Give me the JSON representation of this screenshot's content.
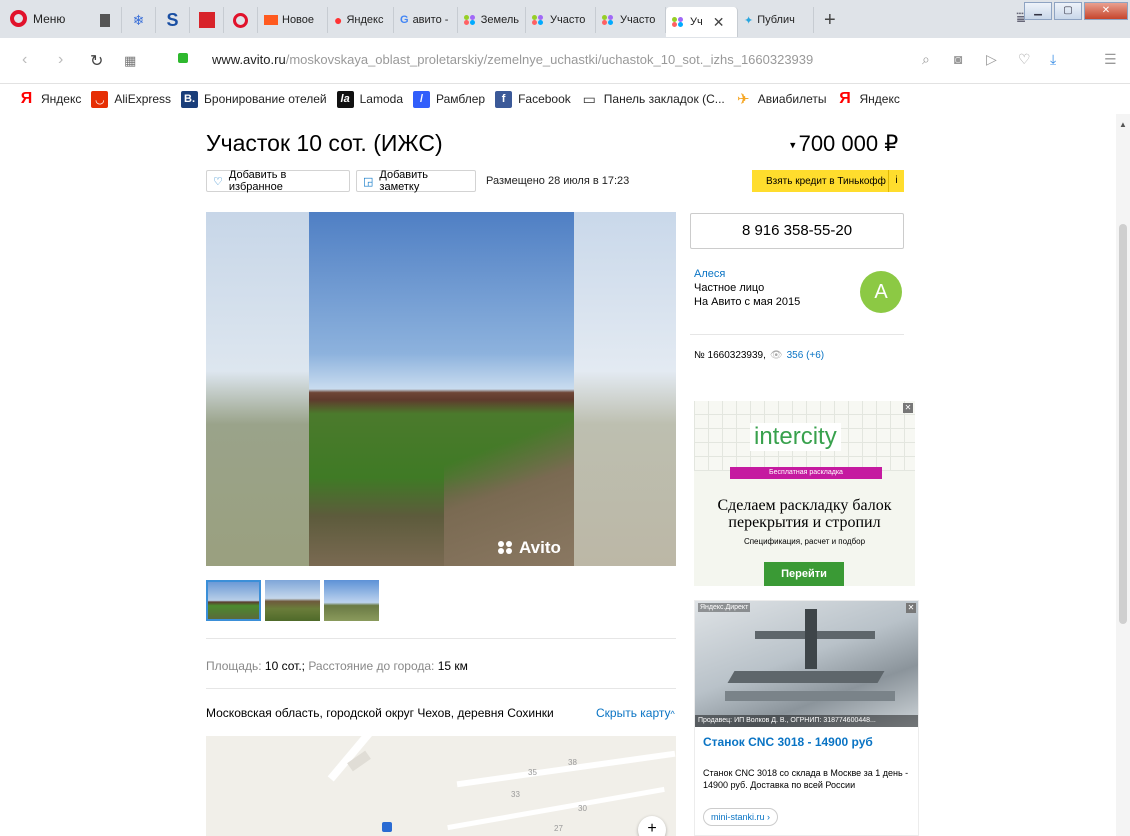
{
  "browser": {
    "menu_label": "Меню",
    "tabs": [
      {
        "label": "Новое"
      },
      {
        "label": "Яндекс"
      },
      {
        "label": "авито -"
      },
      {
        "label": "Земель"
      },
      {
        "label": "Участо"
      },
      {
        "label": "Участо"
      },
      {
        "label": "Уч"
      },
      {
        "label": "Публич"
      }
    ],
    "url_domain": "www.avito.ru",
    "url_path": "/moskovskaya_oblast_proletarskiy/zemelnye_uchastki/uchastok_10_sot._izhs_1660323939",
    "bookmarks": [
      {
        "label": "Яндекс"
      },
      {
        "label": "AliExpress"
      },
      {
        "label": "Бронирование отелей"
      },
      {
        "label": "Lamoda"
      },
      {
        "label": "Рамблер"
      },
      {
        "label": "Facebook"
      },
      {
        "label": "Панель закладок (С..."
      },
      {
        "label": "Авиабилеты"
      },
      {
        "label": "Яндекс"
      }
    ]
  },
  "listing": {
    "title": "Участок 10 сот. (ИЖС)",
    "price": "700 000 ₽",
    "add_favorite": "Добавить в избранное",
    "add_note": "Добавить заметку",
    "posted": "Размещено 28 июля в 17:23",
    "credit_btn": "Взять кредит в Тинькофф",
    "credit_info": "i",
    "photo_watermark": "Avito",
    "param_area_label": "Площадь:",
    "param_area_value": "10 сот.;",
    "param_dist_label": "Расстояние до города:",
    "param_dist_value": "15 км",
    "address": "Московская область, городской округ Чехов, деревня Сохинки",
    "hide_map": "Скрыть карту",
    "map_numbers": [
      "35",
      "38",
      "33",
      "30",
      "27"
    ],
    "map_zoom_in": "+"
  },
  "seller": {
    "phone": "8 916 358-55-20",
    "name": "Алеся",
    "type": "Частное лицо",
    "since": "На Авито с мая 2015",
    "avatar_letter": "А",
    "item_number": "№ 1660323939,",
    "views": "356 (+6)"
  },
  "ads": {
    "intercity": {
      "logo": "intercity",
      "ribbon": "Бесплатная раскладка",
      "headline": "Сделаем раскладку балок перекрытия и стропил",
      "sub": "Спецификация, расчет и подбор",
      "cta": "Перейти"
    },
    "cnc": {
      "badge": "Яндекс.Директ",
      "owner": "Продавец: ИП Волков Д. В., ОГРНИП: 318774600448...",
      "title": "Станок CNC 3018 - 14900 руб",
      "desc": "Станок CNC 3018 со склада в Москве за 1 день - 14900 руб. Доставка по всей России",
      "link": "mini-stanki.ru ›"
    }
  }
}
